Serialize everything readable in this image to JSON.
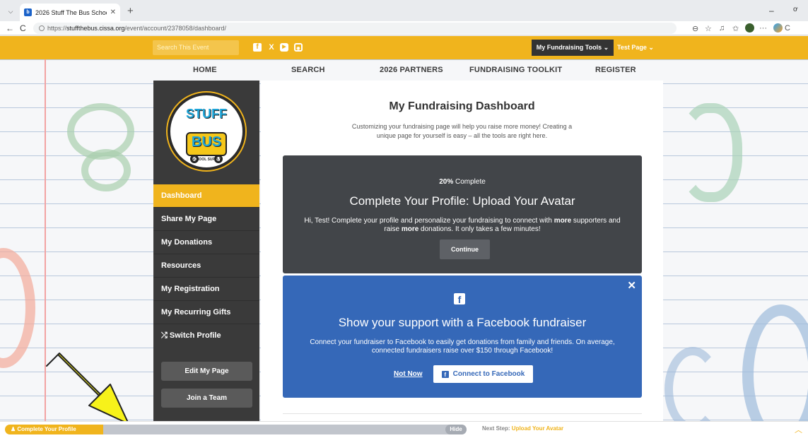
{
  "browser": {
    "tab_title": "2026 Stuff The Bus School Supply",
    "tab_close": "✕",
    "new_tab": "+",
    "url_prefix": "https://",
    "url_host": "stuffthebus.cissa.org",
    "url_path": "/event/account/2378058/dashboard/",
    "back": "←",
    "refresh": "C",
    "minimize": "–",
    "copilot_label": "C"
  },
  "topbar": {
    "search_placeholder": "Search This Event",
    "tools_label": "My Fundraising Tools",
    "test_page_label": "Test Page"
  },
  "nav": {
    "items": [
      "HOME",
      "SEARCH",
      "2026 PARTNERS",
      "FUNDRAISING TOOLKIT",
      "REGISTER"
    ]
  },
  "logo": {
    "line1": "STUFF",
    "line2": "THE",
    "line3": "BUS",
    "tagline": "SCHOOL SUPPLY"
  },
  "sidebar": {
    "items": [
      "Dashboard",
      "Share My Page",
      "My Donations",
      "Resources",
      "My Registration",
      "My Recurring Gifts",
      "Switch Profile"
    ],
    "edit_page": "Edit My Page",
    "join_team": "Join a Team"
  },
  "main": {
    "title": "My Fundraising Dashboard",
    "subtitle": "Customizing your fundraising page will help you raise more money! Creating a unique page for yourself is easy – all the tools are right here."
  },
  "profile_card": {
    "percent": "20%",
    "percent_suffix": " Complete",
    "heading": "Complete Your Profile: Upload Your Avatar",
    "body_1": "Hi, Test! Complete your profile and personalize your fundraising to connect with ",
    "more_1": "more",
    "body_2": " supporters and raise ",
    "more_2": "more",
    "body_3": " donations. It only takes a few minutes!",
    "continue": "Continue"
  },
  "facebook_card": {
    "heading": "Show your support with a Facebook fundraiser",
    "body": "Connect your fundraiser to Facebook to easily get donations from family and friends. On average, connected fundraisers raise over $150 through Facebook!",
    "not_now": "Not Now",
    "connect": "Connect to Facebook"
  },
  "bottom": {
    "badge": "Complete Your Profile",
    "hide": "Hide",
    "next_label": "Next Step:",
    "next_value": "Upload Your Avatar",
    "progress": 0.2
  },
  "colors": {
    "accent": "#f0b41d",
    "dark": "#3a3a3a",
    "facebook": "#3568b8"
  }
}
